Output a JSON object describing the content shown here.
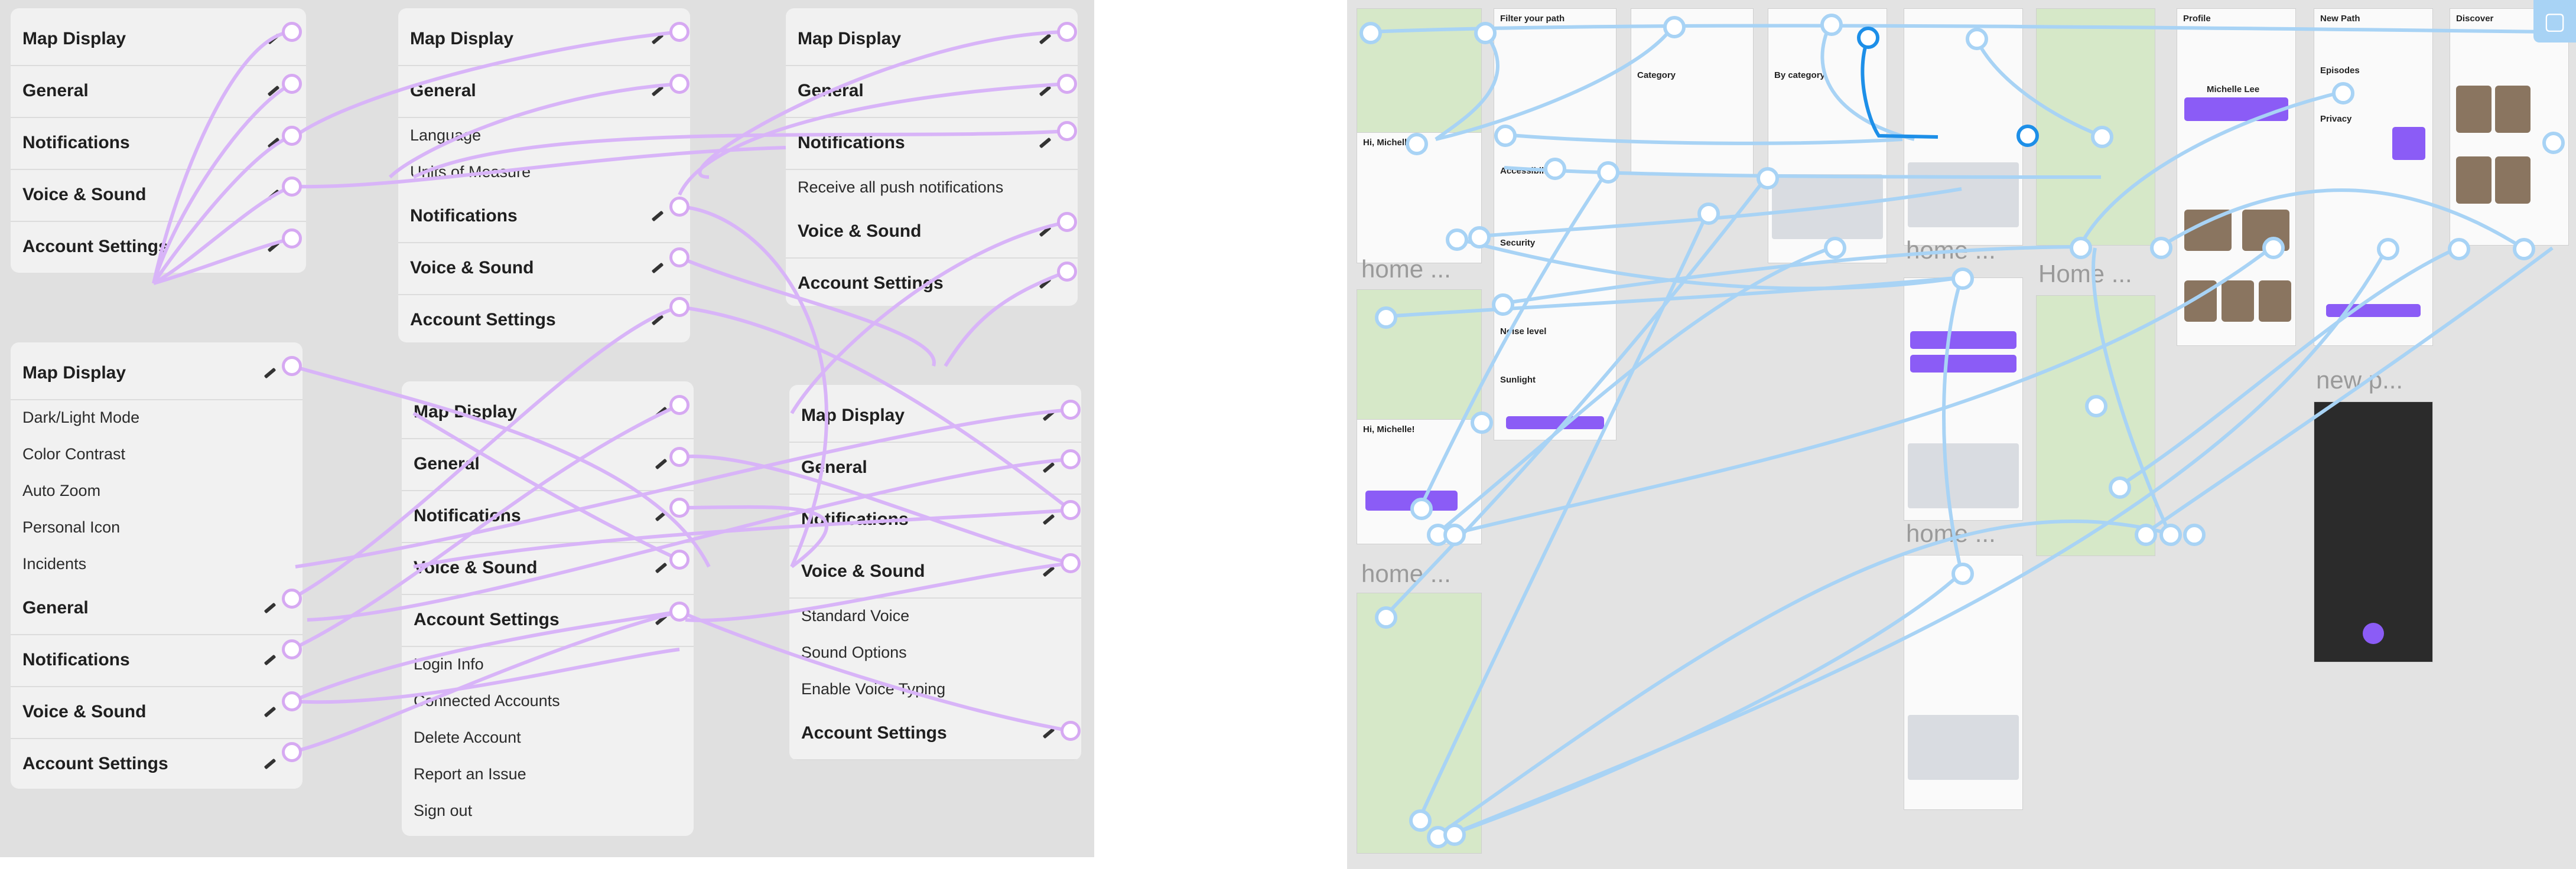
{
  "left": {
    "panels": [
      {
        "id": "p1",
        "rows": [
          {
            "label": "Map Display",
            "kind": "head"
          },
          {
            "label": "General",
            "kind": "head"
          },
          {
            "label": "Notifications",
            "kind": "head"
          },
          {
            "label": "Voice & Sound",
            "kind": "head"
          },
          {
            "label": "Account Settings",
            "kind": "head"
          }
        ]
      },
      {
        "id": "p2",
        "rows": [
          {
            "label": "Map Display",
            "kind": "head"
          },
          {
            "label": "Dark/Light Mode",
            "kind": "sub"
          },
          {
            "label": "Color Contrast",
            "kind": "sub"
          },
          {
            "label": "Auto Zoom",
            "kind": "sub"
          },
          {
            "label": "Personal Icon",
            "kind": "sub"
          },
          {
            "label": "Incidents",
            "kind": "sub"
          },
          {
            "label": "General",
            "kind": "head"
          },
          {
            "label": "Notifications",
            "kind": "head"
          },
          {
            "label": "Voice & Sound",
            "kind": "head"
          },
          {
            "label": "Account Settings",
            "kind": "head"
          }
        ]
      },
      {
        "id": "p3",
        "rows": [
          {
            "label": "Map Display",
            "kind": "head"
          },
          {
            "label": "General",
            "kind": "head"
          },
          {
            "label": "Language",
            "kind": "sub"
          },
          {
            "label": "Units of Measure",
            "kind": "sub"
          },
          {
            "label": "Notifications",
            "kind": "head"
          },
          {
            "label": "Voice & Sound",
            "kind": "head"
          },
          {
            "label": "Account Settings",
            "kind": "head"
          }
        ]
      },
      {
        "id": "p4",
        "rows": [
          {
            "label": "Map Display",
            "kind": "head"
          },
          {
            "label": "General",
            "kind": "head"
          },
          {
            "label": "Notifications",
            "kind": "head"
          },
          {
            "label": "Voice & Sound",
            "kind": "head"
          },
          {
            "label": "Account Settings",
            "kind": "head"
          },
          {
            "label": "Login Info",
            "kind": "sub"
          },
          {
            "label": "Connected Accounts",
            "kind": "sub"
          },
          {
            "label": "Delete Account",
            "kind": "sub"
          },
          {
            "label": "Report an Issue",
            "kind": "sub"
          },
          {
            "label": "Sign out",
            "kind": "sub"
          }
        ]
      },
      {
        "id": "p5",
        "rows": [
          {
            "label": "Map Display",
            "kind": "head"
          },
          {
            "label": "General",
            "kind": "head"
          },
          {
            "label": "Notifications",
            "kind": "head"
          },
          {
            "label": "Receive all push notifications",
            "kind": "sub"
          },
          {
            "label": "Voice & Sound",
            "kind": "head"
          },
          {
            "label": "Account Settings",
            "kind": "head"
          }
        ]
      },
      {
        "id": "p6",
        "rows": [
          {
            "label": "Map Display",
            "kind": "head"
          },
          {
            "label": "General",
            "kind": "head"
          },
          {
            "label": "Notifications",
            "kind": "head"
          },
          {
            "label": "Voice & Sound",
            "kind": "head"
          },
          {
            "label": "Standard Voice",
            "kind": "sub"
          },
          {
            "label": "Sound Options",
            "kind": "sub"
          },
          {
            "label": "Enable Voice Typing",
            "kind": "sub"
          },
          {
            "label": "Account Settings",
            "kind": "head"
          }
        ]
      }
    ]
  },
  "right": {
    "frame_labels": [
      "home ...",
      "home ...",
      "Home ...",
      "home ...",
      "new p..."
    ],
    "screens": {
      "path_title": "Filter your path",
      "category_title": "By category",
      "profile_title": "Profile",
      "profile_name": "Michelle Lee",
      "new_path_title": "New Path",
      "discover_title": "Discover",
      "greeting": "Hi, Michelle!",
      "security_label": "Security",
      "noise_label": "Noise level",
      "sunlight_label": "Sunlight",
      "category_label": "Category",
      "privacy_label": "Privacy",
      "episodes_label": "Episodes",
      "accessibility_label": "Accessibility"
    }
  },
  "colors": {
    "purple_wire": "#d8b4f8",
    "blue_wire": "#a8d3f5",
    "blue_selected": "#1d8fe8",
    "accent": "#8b5cf6"
  }
}
